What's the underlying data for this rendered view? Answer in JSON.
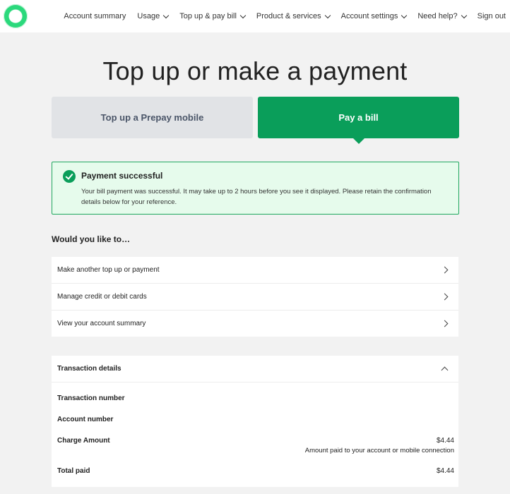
{
  "nav": {
    "items": [
      {
        "label": "Account summary",
        "dropdown": false
      },
      {
        "label": "Usage",
        "dropdown": true
      },
      {
        "label": "Top up & pay bill",
        "dropdown": true
      },
      {
        "label": "Product & services",
        "dropdown": true
      },
      {
        "label": "Account settings",
        "dropdown": true
      },
      {
        "label": "Need help?",
        "dropdown": true
      },
      {
        "label": "Sign out",
        "dropdown": false
      }
    ]
  },
  "page": {
    "title": "Top up or make a payment"
  },
  "tabs": {
    "prepay": "Top up a Prepay mobile",
    "bill": "Pay a bill"
  },
  "alert": {
    "title": "Payment successful",
    "body": "Your bill payment was successful. It may take up to 2 hours before you see it displayed. Please retain the confirmation details below for your reference."
  },
  "options": {
    "heading": "Would you like to…",
    "items": [
      "Make another top up or payment",
      "Manage credit or debit cards",
      "View your account summary"
    ]
  },
  "transaction": {
    "title": "Transaction details",
    "transaction_number_label": "Transaction number",
    "account_number_label": "Account number",
    "charge_label": "Charge Amount",
    "charge_value": "$4.44",
    "charge_note": "Amount paid to your account or mobile connection",
    "total_label": "Total paid",
    "total_value": "$4.44"
  },
  "colors": {
    "brand": "#0a9e5a",
    "alert_bg": "#e6fbec",
    "logo": "#2bd97c"
  }
}
